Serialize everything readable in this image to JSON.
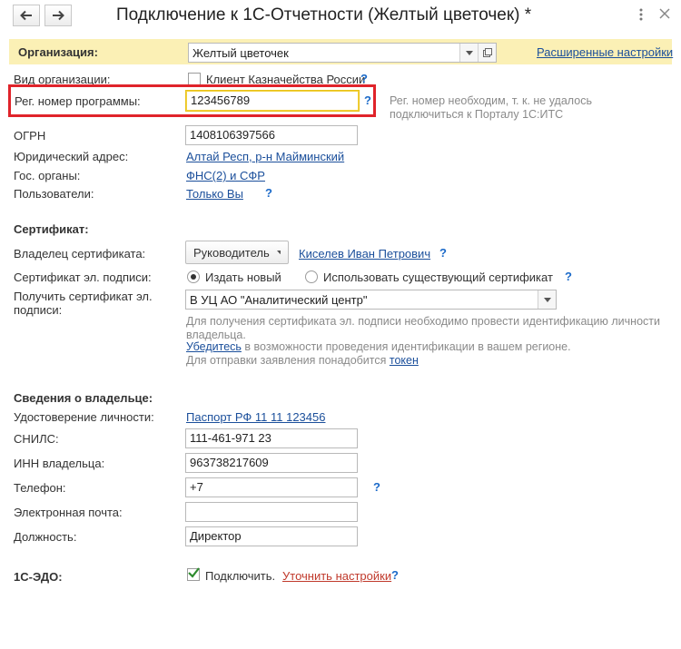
{
  "window": {
    "title": "Подключение к 1С-Отчетности (Желтый цветочек) *",
    "back_icon": "arrow-left-icon",
    "forward_icon": "arrow-right-icon",
    "more_icon": "vertical-dots-icon",
    "close_icon": "close-icon"
  },
  "org": {
    "label": "Организация:",
    "value": "Желтый цветочек",
    "advanced_link": "Расширенные настройки"
  },
  "org_type": {
    "label": "Вид организации:",
    "checkbox_label": "Клиент Казначейства России",
    "checked": false
  },
  "reg_number": {
    "label": "Рег. номер программы:",
    "value": "123456789",
    "hint": "Рег. номер необходим, т. к. не удалось подключиться к Порталу 1С:ИТС"
  },
  "ogrn": {
    "label": "ОГРН",
    "value": "1408106397566"
  },
  "legal_address": {
    "label": "Юридический адрес:",
    "value": "Алтай Респ, р-н Майминский"
  },
  "gov_bodies": {
    "label": "Гос. органы:",
    "value": "ФНС(2) и СФР"
  },
  "users": {
    "label": "Пользователи:",
    "value": "Только Вы"
  },
  "certificate": {
    "section_title": "Сертификат:",
    "owner_label": "Владелец сертификата:",
    "owner_button": "Руководитель",
    "owner_name": "Киселев Иван Петрович",
    "sign_label": "Сертификат эл. подписи:",
    "radio_new": "Издать новый",
    "radio_existing": "Использовать существующий сертификат",
    "selected": "new",
    "get_label": "Получить сертификат эл. подписи:",
    "get_value": "В УЦ АО \"Аналитический центр\"",
    "info_line1": "Для получения сертификата эл. подписи необходимо провести идентификацию личности владельца.",
    "info_link": "Убедитесь",
    "info_line2": " в возможности проведения идентификации в вашем регионе.",
    "info_line3": "Для отправки заявления понадобится ",
    "token_link": "токен"
  },
  "owner": {
    "section_title": "Сведения о владельце:",
    "id_label": "Удостоверение личности:",
    "id_value": "Паспорт РФ 11 11 123456",
    "snils_label": "СНИЛС:",
    "snils_value": "111-461-971 23",
    "inn_label": "ИНН владельца:",
    "inn_value": "963738217609",
    "phone_label": "Телефон:",
    "phone_value": "+7",
    "email_label": "Электронная почта:",
    "email_value": "",
    "position_label": "Должность:",
    "position_value": "Директор"
  },
  "edo": {
    "label": "1С-ЭДО:",
    "checkbox_label": "Подключить.",
    "checked": true,
    "settings_link": "Уточнить настройки"
  },
  "help_mark": "?",
  "colors": {
    "highlight_frame": "#e0232a",
    "org_row_bg": "#fbf0b5",
    "link": "#1b4f9b",
    "help": "#1b6ac9"
  }
}
